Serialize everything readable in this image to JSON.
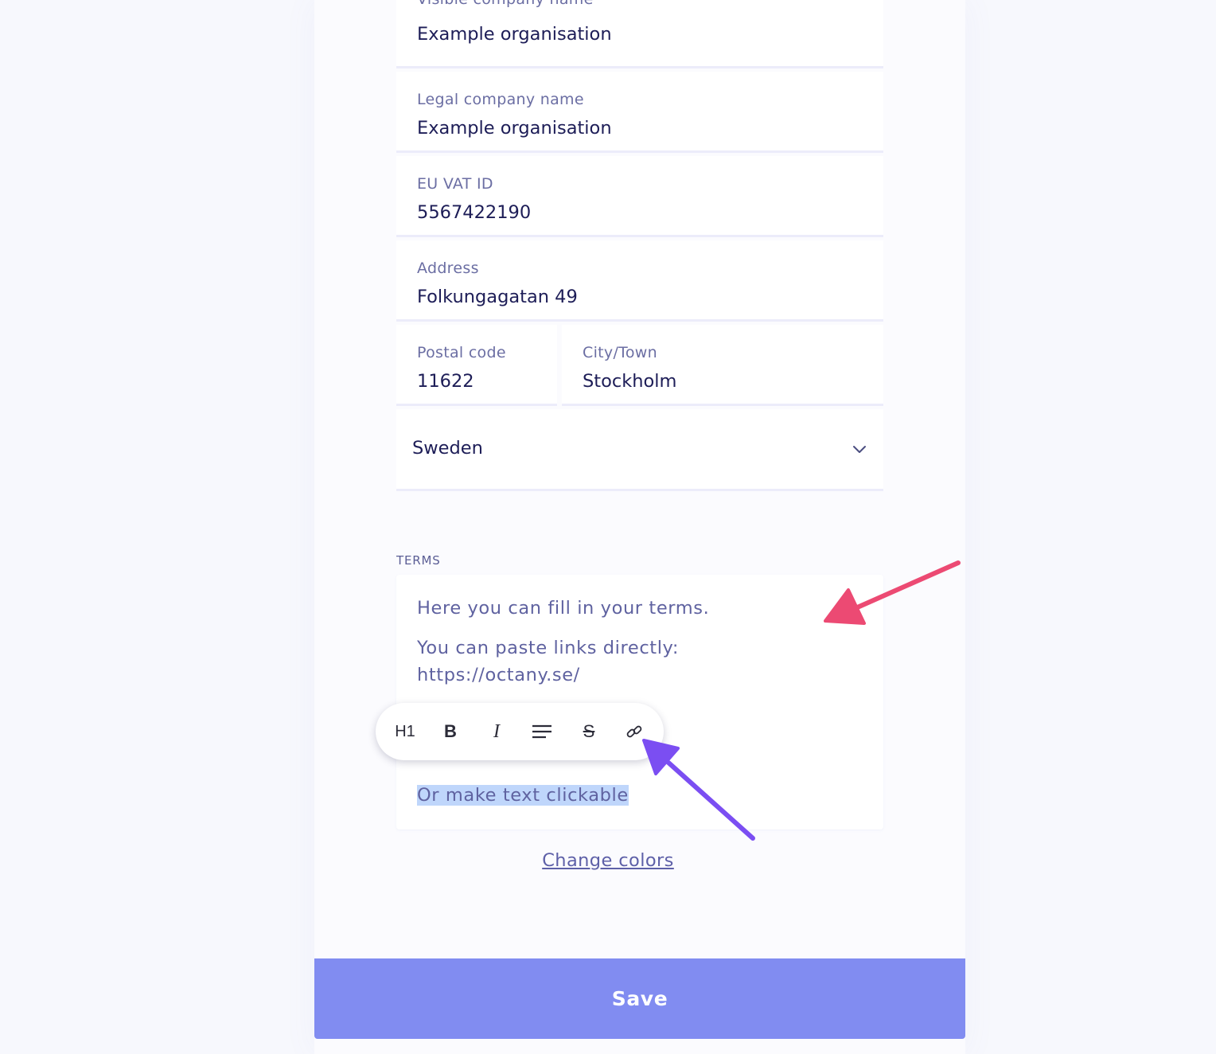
{
  "form": {
    "visible_company_name": {
      "label": "Visible company name",
      "value": "Example organisation"
    },
    "legal_company_name": {
      "label": "Legal company name",
      "value": "Example organisation"
    },
    "eu_vat_id": {
      "label": "EU VAT ID",
      "value": "5567422190"
    },
    "address": {
      "label": "Address",
      "value": "Folkungagatan 49"
    },
    "postal_code": {
      "label": "Postal code",
      "value": "11622"
    },
    "city": {
      "label": "City/Town",
      "value": "Stockholm"
    },
    "country": {
      "value": "Sweden",
      "icon": "chevron-down-icon"
    }
  },
  "terms": {
    "heading": "TERMS",
    "line1": "Here you can fill in your terms.",
    "line2": "You can paste links directly:",
    "line3": "https://octany.se/",
    "selected_text": "Or make text clickable"
  },
  "toolbar": {
    "h1": "H1",
    "bold": "B",
    "italic": "I",
    "strike": "S",
    "align_icon": "align-left-icon",
    "link_icon": "link-icon"
  },
  "change_colors": "Change colors",
  "save_label": "Save",
  "colors": {
    "accent": "#818cf1",
    "pink_arrow": "#ec4a73",
    "purple_arrow": "#7b4ef2",
    "selection": "#bfd6fb"
  }
}
